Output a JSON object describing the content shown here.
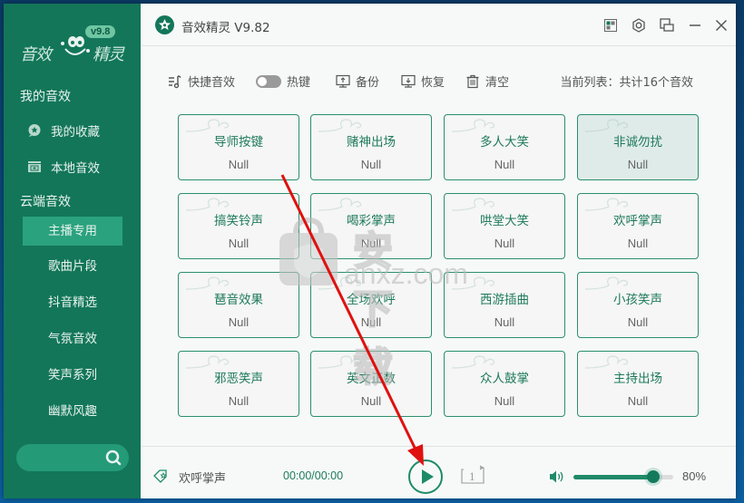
{
  "sidebar": {
    "logo": {
      "left_text": "音效",
      "right_text": "精灵",
      "version_badge": "v9.8"
    },
    "my_sounds_title": "我的音效",
    "my_items": [
      {
        "label": "我的收藏",
        "icon": "favorite-star-icon"
      },
      {
        "label": "本地音效",
        "icon": "local-folder-icon"
      }
    ],
    "cloud_title": "云端音效",
    "categories": [
      {
        "label": "主播专用",
        "active": true
      },
      {
        "label": "歌曲片段",
        "active": false
      },
      {
        "label": "抖音精选",
        "active": false
      },
      {
        "label": "气氛音效",
        "active": false
      },
      {
        "label": "笑声系列",
        "active": false
      },
      {
        "label": "幽默风趣",
        "active": false
      }
    ],
    "search": {
      "placeholder": "",
      "value": ""
    }
  },
  "titlebar": {
    "title": "音效精灵 V9.82",
    "controls": [
      "skin-icon",
      "settings-icon",
      "mini-mode-icon",
      "minimize-icon",
      "close-icon"
    ]
  },
  "toolbar": {
    "quick_sound": "快捷音效",
    "hotkey": "热键",
    "hotkey_enabled": false,
    "backup": "备份",
    "restore": "恢复",
    "clear": "清空",
    "list_info": "当前列表：共计16个音效"
  },
  "sounds": [
    {
      "name": "导师按键",
      "key": "Null",
      "selected": false
    },
    {
      "name": "赌神出场",
      "key": "Null",
      "selected": false
    },
    {
      "name": "多人大笑",
      "key": "Null",
      "selected": false
    },
    {
      "name": "非诚勿扰",
      "key": "Null",
      "selected": true
    },
    {
      "name": "搞笑铃声",
      "key": "Null",
      "selected": false
    },
    {
      "name": "喝彩掌声",
      "key": "Null",
      "selected": false
    },
    {
      "name": "哄堂大笑",
      "key": "Null",
      "selected": false
    },
    {
      "name": "欢呼掌声",
      "key": "Null",
      "selected": false
    },
    {
      "name": "琶音效果",
      "key": "Null",
      "selected": false
    },
    {
      "name": "全场欢呼",
      "key": "Null",
      "selected": false
    },
    {
      "name": "西游插曲",
      "key": "Null",
      "selected": false
    },
    {
      "name": "小孩笑声",
      "key": "Null",
      "selected": false
    },
    {
      "name": "邪恶笑声",
      "key": "Null",
      "selected": false
    },
    {
      "name": "英文正数",
      "key": "Null",
      "selected": false
    },
    {
      "name": "众人鼓掌",
      "key": "Null",
      "selected": false
    },
    {
      "name": "主持出场",
      "key": "Null",
      "selected": false
    }
  ],
  "player": {
    "now_playing": "欢呼掌声",
    "time": "00:00/00:00",
    "loop_mode": "1",
    "volume_percent": 80,
    "volume_text": "80%"
  },
  "watermark": {
    "text_cn": "安下载",
    "text_en": "anxz.com"
  },
  "colors": {
    "brand": "#137659",
    "accent": "#1f8a68",
    "active_item": "#2aa27d"
  }
}
